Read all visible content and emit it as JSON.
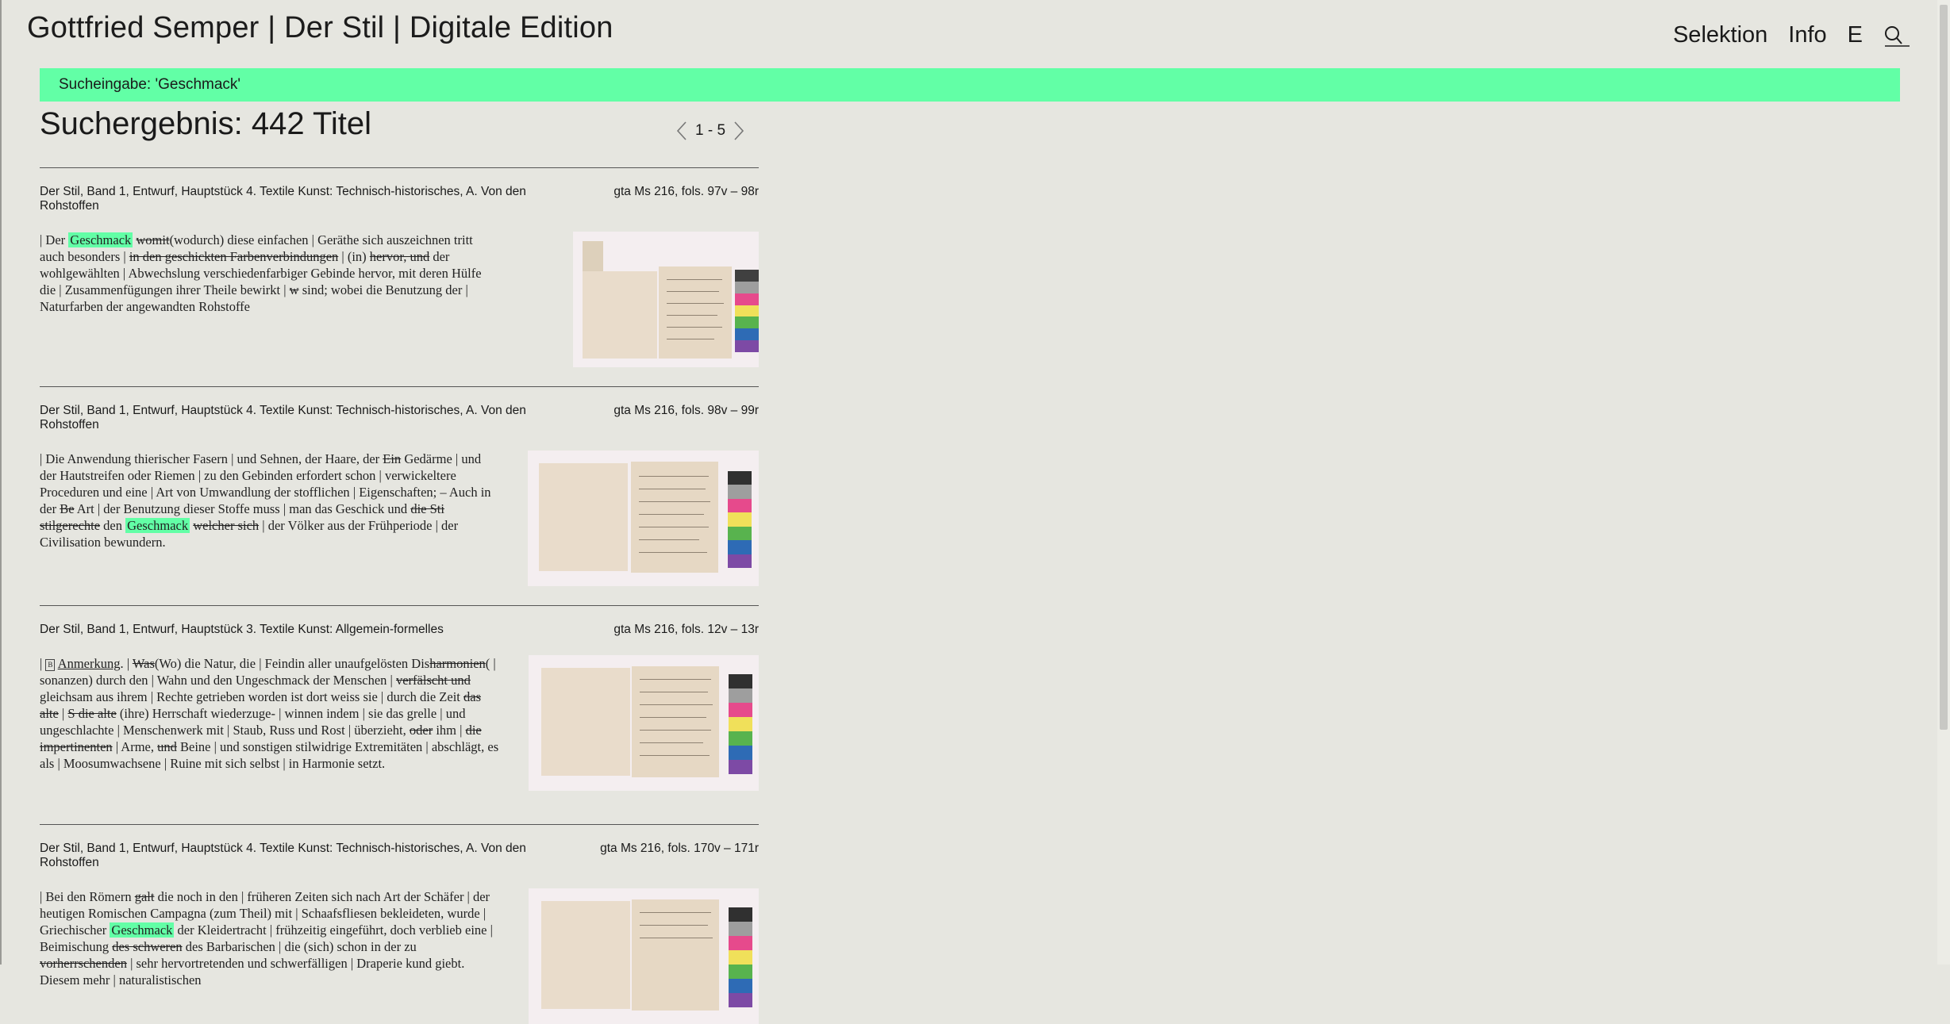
{
  "header": {
    "title": "Gottfried Semper | Der Stil | Digitale Edition",
    "nav": [
      "Selektion",
      "Info",
      "E"
    ]
  },
  "search": {
    "banner": "Sucheingabe: 'Geschmack'"
  },
  "results": {
    "title": "Suchergebnis: 442 Titel",
    "range": "1 - 5"
  },
  "colors": {
    "accent": "#62ffa6",
    "background": "#e6e6e0"
  },
  "icons": [
    "search-icon",
    "chevron-left-icon",
    "chevron-right-icon"
  ],
  "entries": [
    {
      "title": "Der Stil, Band 1, Entwurf, Hauptstück 4. Textile Kunst: Technisch-historisches, A. Von den Rohstoffen",
      "signature": "gta Ms 216, fols. 97v – 98r",
      "text": "| Der Geschmack womit(wodurch) diese einfachen | Geräthe sich auszeichnen tritt auch besonders | in den geschickten Farbenverbindungen | (in) hervor, und der wohlgewählten | Abwechslung verschiedenfarbiger Gebinde hervor, mit deren Hülfe die | Zusammenfügungen ihrer Theile bewirkt | w sind; wobei die Benutzung der | Naturfarben der angewandten Rohstoffe"
    },
    {
      "title": "Der Stil, Band 1, Entwurf, Hauptstück 4. Textile Kunst: Technisch-historisches, A. Von den Rohstoffen",
      "signature": "gta Ms 216, fols. 98v – 99r",
      "text": "| Die Anwendung thierischer Fasern | und Sehnen, der Haare, der Ein Gedärme | und der Hautstreifen oder Riemen | zu den Gebinden erfordert schon | verwickeltere Proceduren und eine | Art von Umwandlung der stofflichen | Eigenschaften; – Auch in der Be Art | der Benutzung dieser Stoffe muss | man das Geschick und die Sti stilgerechte den Geschmack welcher sich | der Völker aus der Frühperiode | der Civilisation bewundern."
    },
    {
      "title": "Der Stil, Band 1, Entwurf, Hauptstück 3. Textile Kunst: Allgemein-formelles",
      "signature": "gta Ms 216, fols. 12v – 13r",
      "text": "| Anmerkung. | Was(Wo) die Natur, die | Feindin aller unaufgelösten Disharmonien( | sonanzen) durch den | Wahn und den Ungeschmack der Menschen | verfälscht und gleichsam aus ihrem | Rechte getrieben worden ist dort weiss sie | durch die Zeit das alte | S die alte (ihre) Herrschaft wiederzuge- | winnen indem | sie das grelle | und ungeschlachte | Menschenwerk mit | Staub, Russ und Rost | überzieht, oder ihm | die impertinenten | Arme, und Beine | und sonstigen stilwidrige Extremitäten | abschlägt, es als | Moosumwachsene | Ruine mit sich selbst | in Harmonie setzt."
    },
    {
      "title": "Der Stil, Band 1, Entwurf, Hauptstück 4. Textile Kunst: Technisch-historisches, A. Von den Rohstoffen",
      "signature": "gta Ms 216, fols. 170v – 171r",
      "text": "| Bei den Römern galt die noch in den | früheren Zeiten sich nach Art der Schäfer | der heutigen Romischen Campagna (zum Theil) mit | Schaafsfliesen bekleideten, wurde | Griechischer Geschmack der Kleidertracht | frühzeitig eingeführt, doch verblieb eine | Beimischung des schweren des Barbarischen | die (sich) schon in der zu vorherrschenden | sehr hervortretenden und schwerfälligen | Draperie kund giebt. Diesem mehr | naturalistischen"
    }
  ]
}
